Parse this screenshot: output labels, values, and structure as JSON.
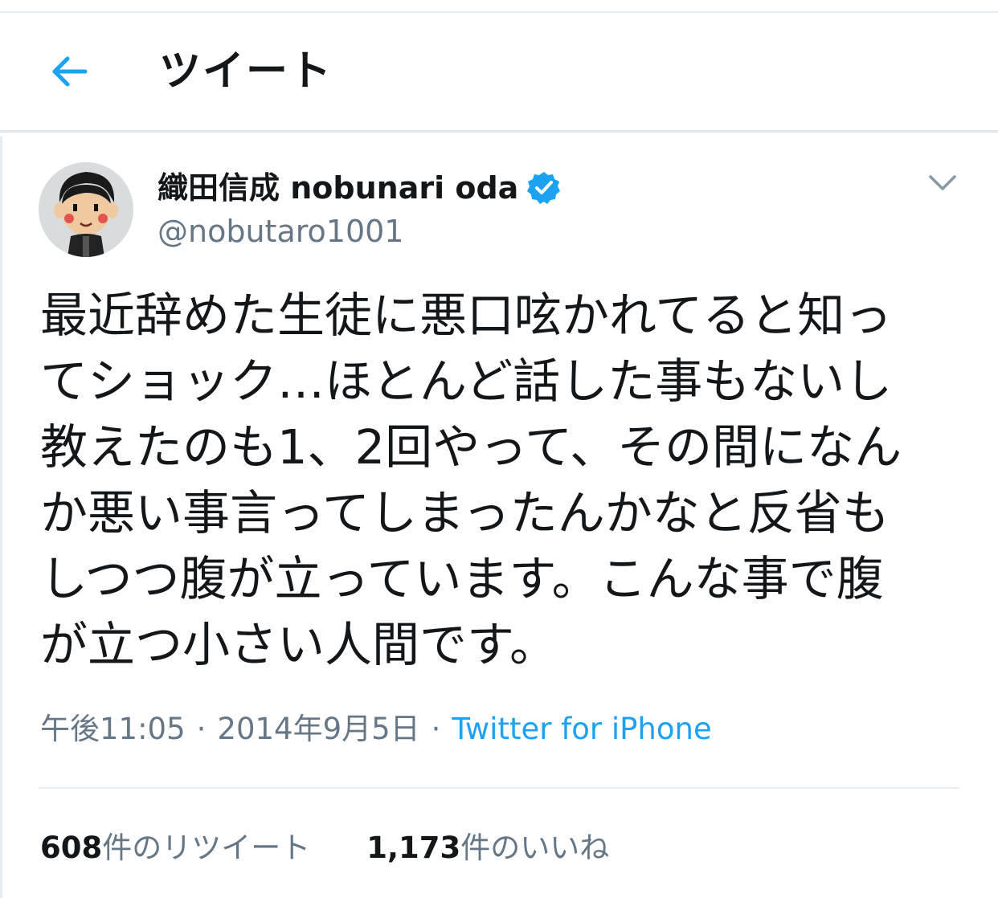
{
  "header": {
    "back_icon": "arrow-left-icon",
    "title": "ツイート",
    "accent": "#1da1f2"
  },
  "tweet": {
    "author": {
      "display_name": "織田信成 nobunari oda",
      "handle": "@nobutaro1001",
      "verified": true,
      "verified_icon": "verified-badge-icon"
    },
    "menu_icon": "chevron-down-icon",
    "text_lines": [
      "最近辞めた生徒に悪口呟かれてると知っ",
      "てショック…ほとんど話した事もないし",
      "教えたのも1、2回やって、その間になん",
      "か悪い事言ってしまったんかなと反省も",
      "しつつ腹が立っています。こんな事で腹",
      "が立つ小さい人間です。"
    ],
    "timestamp": "午後11:05",
    "date": "2014年9月5日",
    "separator": "·",
    "source": "Twitter for iPhone",
    "retweets": {
      "count": "608",
      "label": "件のリツイート"
    },
    "likes": {
      "count": "1,173",
      "label": "件のいいね"
    }
  },
  "colors": {
    "text_primary": "#14171a",
    "text_secondary": "#657786",
    "link": "#1da1f2",
    "border": "#e6ecf0"
  }
}
